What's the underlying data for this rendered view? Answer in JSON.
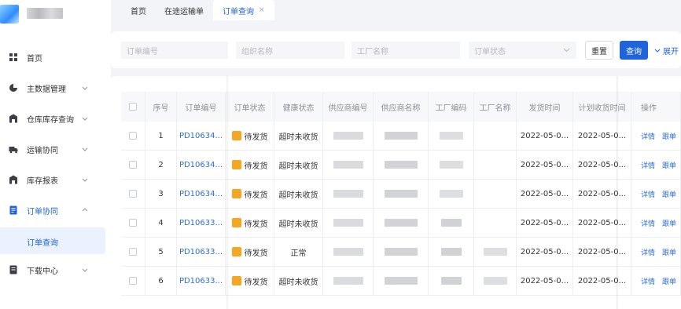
{
  "sidebar": {
    "items": [
      {
        "label": "首页",
        "icon": "home-icon",
        "has_chevron": false
      },
      {
        "label": "主数据管理",
        "icon": "database-icon",
        "has_chevron": true
      },
      {
        "label": "仓库库存查询",
        "icon": "warehouse-icon",
        "has_chevron": true
      },
      {
        "label": "运输协同",
        "icon": "truck-icon",
        "has_chevron": true
      },
      {
        "label": "库存报表",
        "icon": "report-icon",
        "has_chevron": true
      },
      {
        "label": "订单协同",
        "icon": "order-icon",
        "has_chevron": true,
        "expanded": true
      },
      {
        "label": "下载中心",
        "icon": "download-icon",
        "has_chevron": true
      }
    ],
    "active_sub": "订单查询"
  },
  "tabs": [
    {
      "label": "首页"
    },
    {
      "label": "在途运输单"
    },
    {
      "label": "订单查询",
      "active": true,
      "close": "×"
    }
  ],
  "filter": {
    "order_no_placeholder": "订单编号",
    "org_placeholder": "组织名称",
    "factory_placeholder": "工厂名称",
    "status_placeholder": "订单状态",
    "reset_label": "重置",
    "query_label": "查询",
    "expand_label": "展开"
  },
  "table": {
    "headers": [
      "序号",
      "订单编号",
      "订单状态",
      "健康状态",
      "供应商编号",
      "供应商名称",
      "工厂编码",
      "工厂名称",
      "发货时间",
      "计划收货时间",
      "操作"
    ],
    "rows": [
      {
        "no": "1",
        "order": "PD10634...",
        "status": "待发货",
        "health": "超时未收货",
        "ship": "2022-05-0...",
        "plan": "2022-05-0..."
      },
      {
        "no": "2",
        "order": "PD10634...",
        "status": "待发货",
        "health": "超时未收货",
        "ship": "2022-05-0...",
        "plan": "2022-05-0..."
      },
      {
        "no": "3",
        "order": "PD10634...",
        "status": "待发货",
        "health": "超时未收货",
        "ship": "2022-05-0...",
        "plan": "2022-05-0..."
      },
      {
        "no": "4",
        "order": "PD10633...",
        "status": "待发货",
        "health": "超时未收货",
        "ship": "2022-05-0...",
        "plan": "2022-05-0..."
      },
      {
        "no": "5",
        "order": "PD10633...",
        "status": "待发货",
        "health": "正常",
        "ship": "2022-05-0...",
        "plan": "2022-05-0..."
      },
      {
        "no": "6",
        "order": "PD10633...",
        "status": "待发货",
        "health": "超时未收货",
        "ship": "2022-05-0...",
        "plan": "2022-05-0..."
      }
    ],
    "ops": {
      "detail": "详情",
      "track": "跟单"
    }
  },
  "colors": {
    "accent": "#1f64d8",
    "status_pending": "#f5a623"
  }
}
